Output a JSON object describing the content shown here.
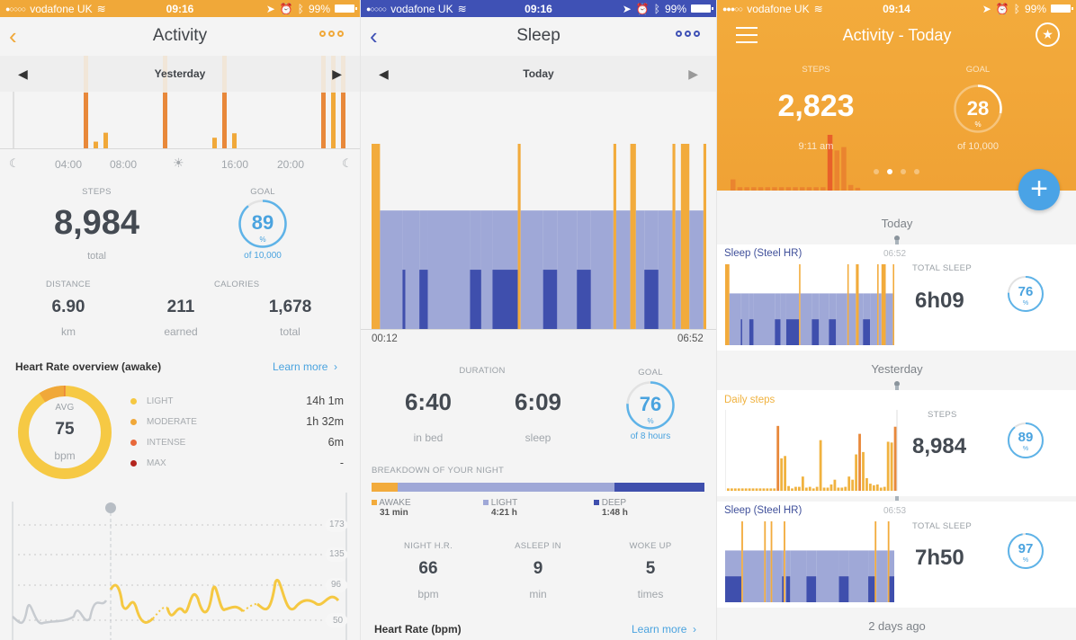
{
  "colors": {
    "activity": "#f0a839",
    "sleep_nav": "#3f51b5",
    "light": "#9fa8d7",
    "deep": "#3f4fad",
    "awake": "#f2ab3c",
    "blue": "#4aa3df"
  },
  "status_bars": [
    {
      "carrier": "vodafone UK",
      "time": "09:16",
      "battery": "99%"
    },
    {
      "carrier": "vodafone UK",
      "time": "09:16",
      "battery": "99%"
    },
    {
      "carrier": "vodafone UK",
      "time": "09:14",
      "battery": "99%"
    }
  ],
  "activity": {
    "title": "Activity",
    "back_icon": "‹",
    "date": "Yesterday",
    "time_ticks": [
      "04:00",
      "08:00",
      "16:00",
      "20:00"
    ],
    "steps": {
      "label": "STEPS",
      "value": "8,984",
      "sub": "total"
    },
    "goal": {
      "label": "GOAL",
      "percent": "89",
      "pct_sign": "%",
      "of": "of 10,000",
      "fraction": 0.89
    },
    "distance": {
      "label": "DISTANCE",
      "value": "6.90",
      "unit": "km"
    },
    "calories": {
      "label": "CALORIES",
      "earned": "211",
      "earned_label": "earned",
      "total": "1,678",
      "total_label": "total"
    },
    "hr_overview": {
      "title": "Heart Rate overview (awake)",
      "learn_more": "Learn more",
      "avg_label": "AVG",
      "avg_value": "75",
      "avg_unit": "bpm",
      "zones": [
        {
          "name": "LIGHT",
          "value": "14h 1m",
          "color": "#f5c842"
        },
        {
          "name": "MODERATE",
          "value": "1h 32m",
          "color": "#f0a839"
        },
        {
          "name": "INTENSE",
          "value": "6m",
          "color": "#e8683a"
        },
        {
          "name": "MAX",
          "value": "-",
          "color": "#b3251e"
        }
      ]
    },
    "hr_axis": [
      "173",
      "135",
      "96",
      "50"
    ],
    "hourly_steps": [
      0,
      0,
      0,
      0,
      0,
      0,
      0,
      1,
      0.12,
      0.28,
      0,
      0,
      0,
      0,
      0,
      1,
      0,
      0,
      0,
      0,
      0.19,
      1,
      0.27,
      0,
      0,
      0,
      0,
      0,
      0,
      0,
      0,
      1,
      1,
      1
    ]
  },
  "sleep": {
    "title": "Sleep",
    "date": "Today",
    "start": "00:12",
    "end": "06:52",
    "duration_label": "DURATION",
    "in_bed": "6:40",
    "in_bed_label": "in bed",
    "sleep": "6:09",
    "sleep_label": "sleep",
    "goal": {
      "label": "GOAL",
      "percent": "76",
      "pct_sign": "%",
      "of": "of 8 hours",
      "fraction": 0.76
    },
    "breakdown_title": "BREAKDOWN OF YOUR NIGHT",
    "breakdown": [
      {
        "name": "AWAKE",
        "value": "31 min",
        "fraction": 0.078
      },
      {
        "name": "LIGHT",
        "value": "4:21 h",
        "fraction": 0.652
      },
      {
        "name": "DEEP",
        "value": "1:48 h",
        "fraction": 0.27
      }
    ],
    "stats": [
      {
        "label": "NIGHT H.R.",
        "value": "66",
        "unit": "bpm"
      },
      {
        "label": "ASLEEP IN",
        "value": "9",
        "unit": "min"
      },
      {
        "label": "WOKE UP",
        "value": "5",
        "unit": "times"
      }
    ],
    "hr_title": "Heart Rate (bpm)",
    "learn_more": "Learn more"
  },
  "dashboard": {
    "title": "Activity - Today",
    "steps_label": "STEPS",
    "steps": "2,823",
    "time": "9:11 am",
    "goal_label": "GOAL",
    "goal_percent": "28",
    "pct_sign": "%",
    "goal_of": "of 10,000",
    "goal_fraction": 0.28,
    "fab": "+",
    "timeline": [
      {
        "label": "Today"
      },
      {
        "label": "Yesterday"
      },
      {
        "label": "2 days ago"
      }
    ],
    "cards": [
      {
        "title": "Sleep (Steel HR)",
        "time": "06:52",
        "metric_label": "TOTAL SLEEP",
        "metric": "6h09",
        "percent": "76",
        "fraction": 0.76
      },
      {
        "title": "Daily steps",
        "time": "",
        "metric_label": "STEPS",
        "metric": "8,984",
        "percent": "89",
        "fraction": 0.89
      },
      {
        "title": "Sleep (Steel HR)",
        "time": "06:53",
        "metric_label": "TOTAL SLEEP",
        "metric": "7h50",
        "percent": "97",
        "fraction": 0.97
      }
    ]
  }
}
